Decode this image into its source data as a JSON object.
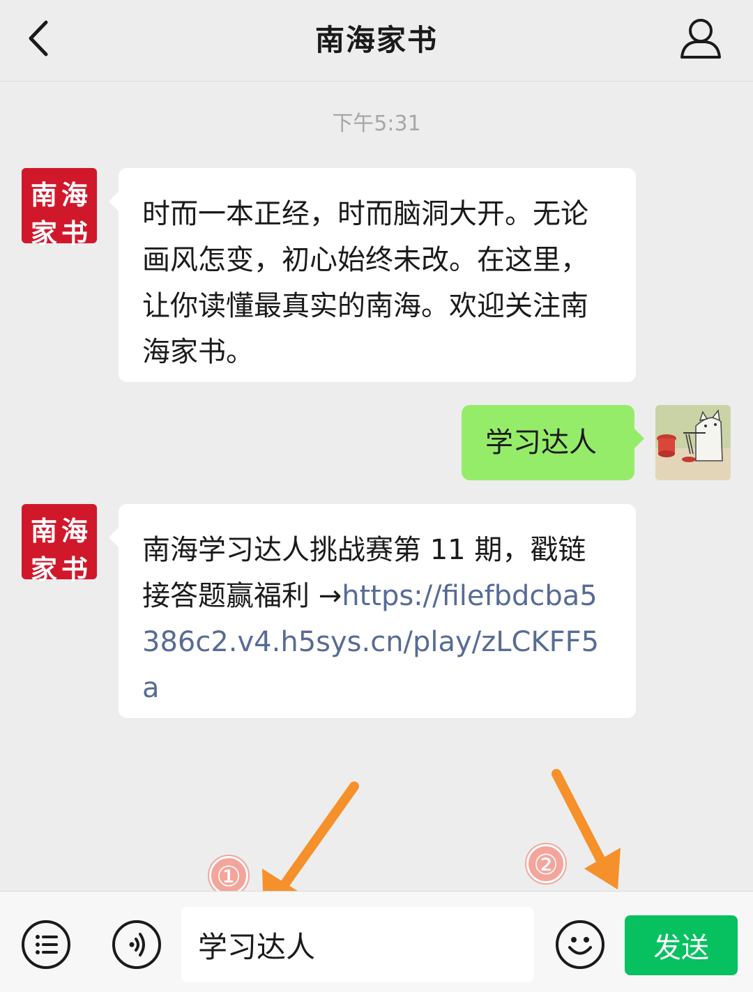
{
  "header": {
    "title": "南海家书",
    "back_icon": "chevron-left-icon",
    "profile_icon": "person-icon"
  },
  "chat": {
    "timestamp": "下午5:31",
    "account_avatar_text": [
      "南",
      "海",
      "家",
      "书"
    ],
    "messages": [
      {
        "from": "account",
        "text": "时而一本正经，时而脑洞大开。无论画风怎变，初心始终未改。在这里，让你读懂最真实的南海。欢迎关注南海家书。"
      },
      {
        "from": "me",
        "text": "学习达人"
      },
      {
        "from": "account",
        "text_prefix": "南海学习达人挑战赛第 11 期，戳链接答题赢福利 →",
        "link": "https://filefbdcba5386c2.v4.h5sys.cn/play/zLCKFF5a"
      }
    ]
  },
  "annotations": {
    "step1": "①",
    "step2": "②",
    "arrow_color": "#f5902b"
  },
  "input_bar": {
    "menu_icon": "list-icon",
    "voice_icon": "voice-icon",
    "emoji_icon": "emoji-icon",
    "input_value": "学习达人",
    "send_label": "发送"
  },
  "colors": {
    "background": "#ededed",
    "my_bubble": "#95ec69",
    "send_button": "#07c160",
    "link": "#576b95",
    "avatar_red": "#d1182b"
  }
}
